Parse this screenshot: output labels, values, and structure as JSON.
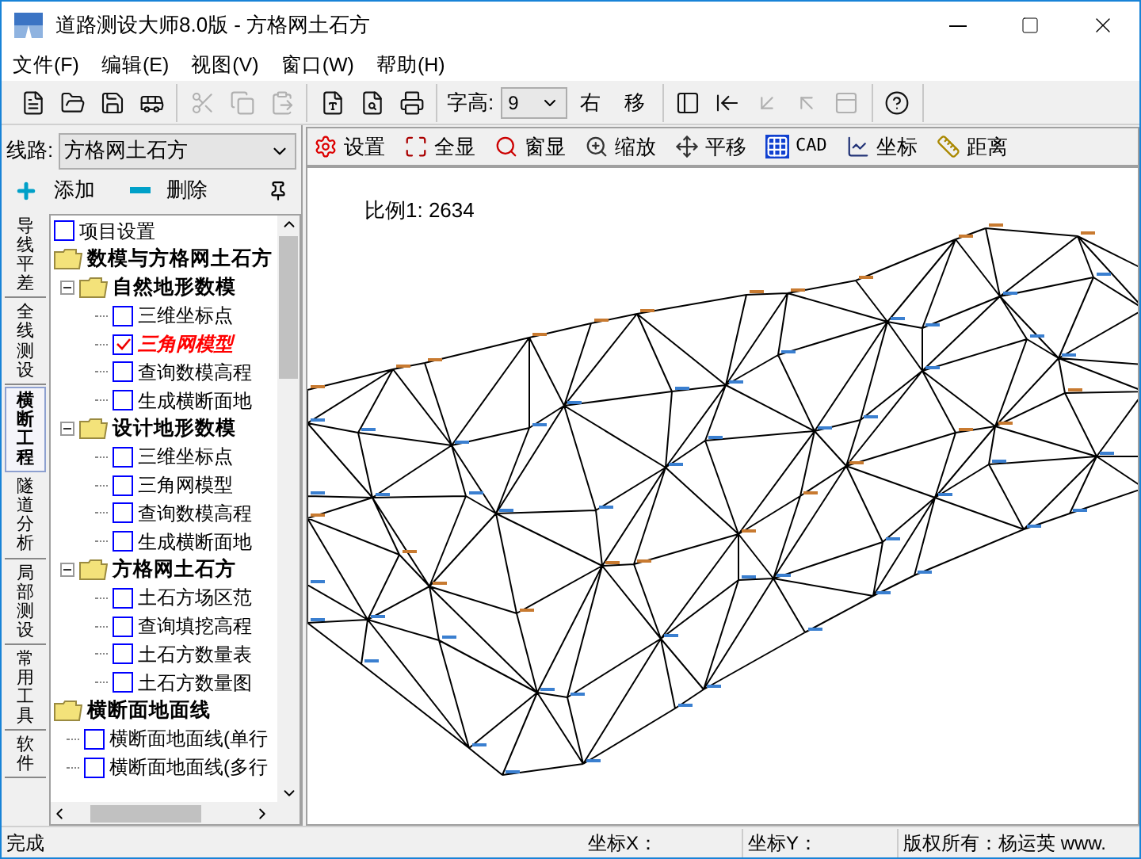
{
  "window": {
    "title": "道路测设大师8.0版 - 方格网土石方"
  },
  "menu": [
    "文件(F)",
    "编辑(E)",
    "视图(V)",
    "窗口(W)",
    "帮助(H)"
  ],
  "toolbar": {
    "groups": [
      [
        {
          "kind": "icon",
          "disabled": false
        },
        {
          "kind": "icon",
          "disabled": false
        },
        {
          "kind": "icon",
          "disabled": false
        },
        {
          "kind": "icon",
          "disabled": false
        }
      ],
      [
        {
          "kind": "icon",
          "disabled": true
        },
        {
          "kind": "icon",
          "disabled": true
        },
        {
          "kind": "icon",
          "disabled": true
        }
      ],
      [
        {
          "kind": "icon",
          "disabled": false
        },
        {
          "kind": "icon",
          "disabled": false
        },
        {
          "kind": "icon",
          "disabled": false
        }
      ],
      [
        {
          "kind": "label",
          "text": "字高:"
        },
        {
          "kind": "select",
          "text": "9"
        },
        {
          "kind": "text",
          "text": "右"
        },
        {
          "kind": "text",
          "text": "移"
        }
      ],
      [
        {
          "kind": "icon",
          "disabled": false
        },
        {
          "kind": "icon",
          "disabled": false
        },
        {
          "kind": "icon",
          "disabled": true
        },
        {
          "kind": "icon",
          "disabled": true
        },
        {
          "kind": "icon",
          "disabled": true
        }
      ],
      [
        {
          "kind": "icon",
          "disabled": false
        }
      ]
    ]
  },
  "route": {
    "label": "线路:",
    "value": "方格网土石方"
  },
  "actions": [
    "添加",
    "删除"
  ],
  "side_tabs": [
    {
      "label": "导线平差",
      "selected": false
    },
    {
      "label": "全线测设",
      "selected": false
    },
    {
      "label": "横断工程",
      "selected": true
    },
    {
      "label": "隧道分析",
      "selected": false
    },
    {
      "label": "局部测设",
      "selected": false
    },
    {
      "label": "常用工具",
      "selected": false
    },
    {
      "label": "软件",
      "selected": false
    }
  ],
  "tree": [
    {
      "kind": "item",
      "label": "项目设置",
      "checked": false
    },
    {
      "kind": "folder",
      "label": "数模与方格网土石方",
      "children": [
        {
          "kind": "folder",
          "label": "自然地形数模",
          "expanded": true,
          "children": [
            {
              "kind": "item",
              "label": "三维坐标点",
              "checked": false
            },
            {
              "kind": "item",
              "label": "三角网模型",
              "checked": true
            },
            {
              "kind": "item",
              "label": "查询数模高程",
              "checked": false
            },
            {
              "kind": "item",
              "label": "生成横断面地",
              "checked": false
            }
          ]
        },
        {
          "kind": "folder",
          "label": "设计地形数模",
          "expanded": true,
          "children": [
            {
              "kind": "item",
              "label": "三维坐标点",
              "checked": false
            },
            {
              "kind": "item",
              "label": "三角网模型",
              "checked": false
            },
            {
              "kind": "item",
              "label": "查询数模高程",
              "checked": false
            },
            {
              "kind": "item",
              "label": "生成横断面地",
              "checked": false
            }
          ]
        },
        {
          "kind": "folder",
          "label": "方格网土石方",
          "expanded": true,
          "children": [
            {
              "kind": "item",
              "label": "土石方场区范",
              "checked": false
            },
            {
              "kind": "item",
              "label": "查询填挖高程",
              "checked": false
            },
            {
              "kind": "item",
              "label": "土石方数量表",
              "checked": false
            },
            {
              "kind": "item",
              "label": "土石方数量图",
              "checked": false
            }
          ]
        }
      ]
    },
    {
      "kind": "folder",
      "label": "横断面地面线",
      "children": [
        {
          "kind": "item",
          "label": "横断面地面线(单行",
          "checked": false
        },
        {
          "kind": "item",
          "label": "横断面地面线(多行",
          "checked": false
        }
      ]
    }
  ],
  "drawing_toolbar": [
    "设置",
    "全显",
    "窗显",
    "缩放",
    "平移",
    "CAD",
    "坐标",
    "距离"
  ],
  "canvas": {
    "scale": "比例1: 2634"
  },
  "status_bar": [
    "完成",
    "坐标X：",
    "坐标Y：",
    "版权所有：杨运英 www."
  ]
}
